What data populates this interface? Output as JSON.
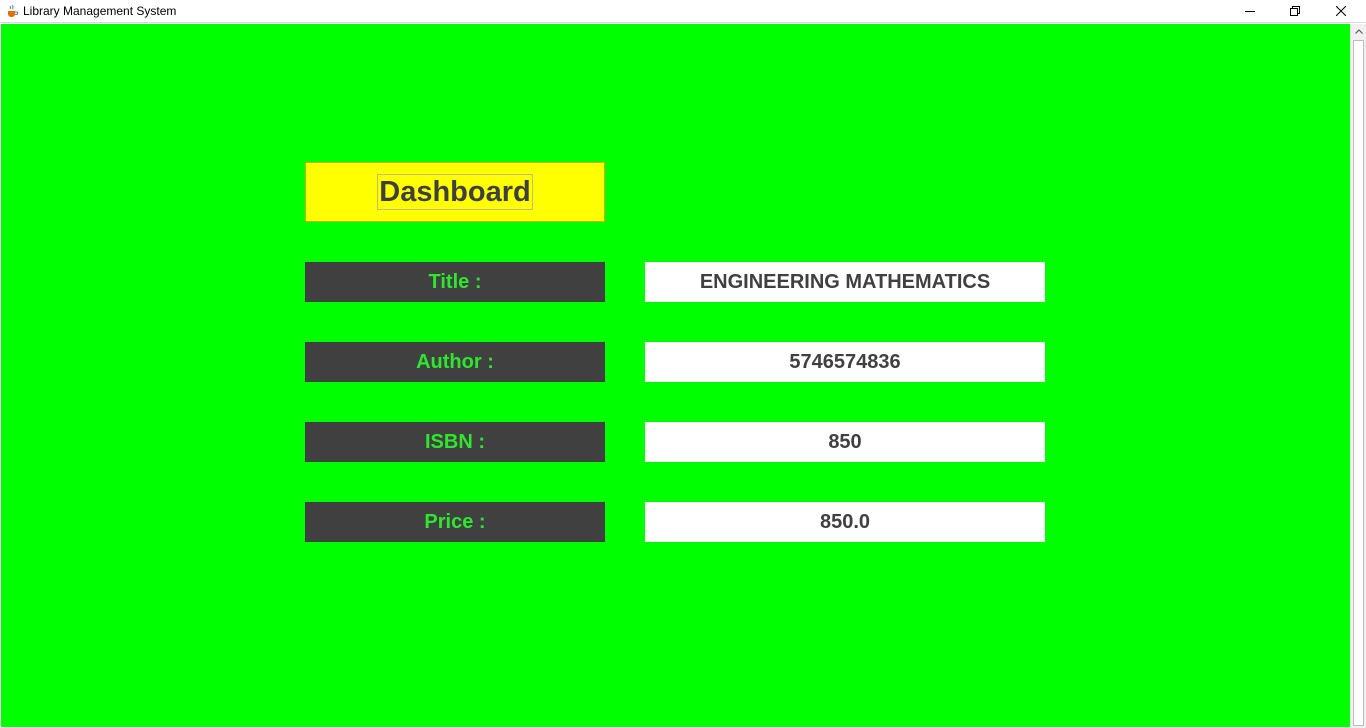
{
  "window": {
    "title": "Library Management System",
    "icons": {
      "app": "java-coffee-icon",
      "minimize": "minimize-icon",
      "maximize": "restore-icon",
      "close": "close-icon"
    }
  },
  "dashboard": {
    "heading": "Dashboard",
    "fields": [
      {
        "label": "Title :",
        "value": "ENGINEERING MATHEMATICS"
      },
      {
        "label": "Author :",
        "value": "5746574836"
      },
      {
        "label": "ISBN :",
        "value": "850"
      },
      {
        "label": "Price :",
        "value": "850.0"
      }
    ]
  },
  "colors": {
    "background": "#00ff00",
    "heading_bg": "#ffff00",
    "label_bg": "#404040",
    "label_text": "#2ee62e",
    "value_bg": "#ffffff",
    "value_text": "#404040"
  }
}
